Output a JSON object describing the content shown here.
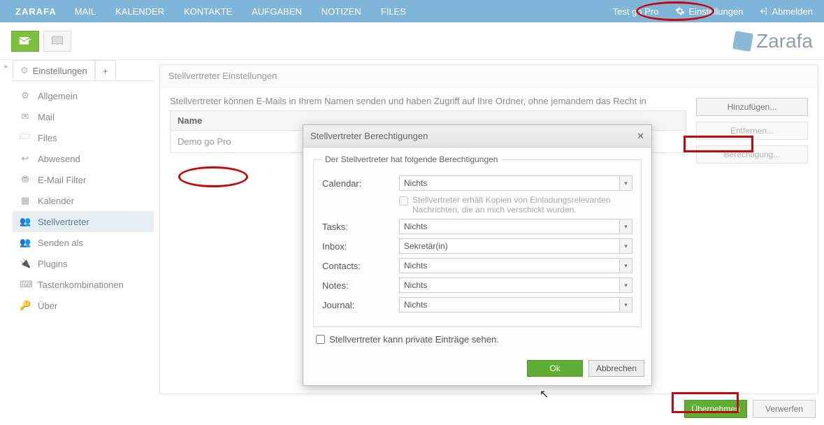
{
  "topnav": {
    "brand": "ZARAFA",
    "items": [
      "MAIL",
      "KALENDER",
      "KONTAKTE",
      "AUFGABEN",
      "NOTIZEN",
      "FILES"
    ],
    "user": "Test go Pro",
    "settings": "Einstellungen",
    "logout": "Abmelden"
  },
  "logo_text": "Zarafa",
  "tabs": {
    "settings_tab": "Einstellungen"
  },
  "sidenav": [
    {
      "label": "Allgemein",
      "icon": "⚙"
    },
    {
      "label": "Mail",
      "icon": "✉"
    },
    {
      "label": "Files",
      "icon": "🗁"
    },
    {
      "label": "Abwesend",
      "icon": "↩"
    },
    {
      "label": "E-Mail Filter",
      "icon": "⛃"
    },
    {
      "label": "Kalender",
      "icon": "▦"
    },
    {
      "label": "Stellvertreter",
      "icon": "👥"
    },
    {
      "label": "Senden als",
      "icon": "👥"
    },
    {
      "label": "Plugins",
      "icon": "🔌"
    },
    {
      "label": "Tastenkombinationen",
      "icon": "⌨"
    },
    {
      "label": "Über",
      "icon": "🔑"
    }
  ],
  "panel": {
    "title": "Stellvertreter Einstellungen",
    "desc": "Stellvertreter können E-Mails in Ihrem Namen senden und haben Zugriff auf Ihre Ordner, ohne jemandem das Recht in",
    "name_col": "Name",
    "row0": "Demo go Pro",
    "add": "Hinzufügen...",
    "remove": "Entfernen...",
    "perm": "Berechtigung..."
  },
  "footer": {
    "apply": "Übernehmen",
    "discard": "Verwerfen"
  },
  "modal": {
    "title": "Stellvertreter Berechtigungen",
    "legend": "Der Stellvertreter hat folgende Berechtigungen",
    "calendar_lbl": "Calendar:",
    "calendar_val": "Nichts",
    "copy_check": "Stellvertreter erhält Kopien von Einladungsrelevanten Nachrichten, die an mich verschickt wurden.",
    "tasks_lbl": "Tasks:",
    "tasks_val": "Nichts",
    "inbox_lbl": "Inbox:",
    "inbox_val": "Sekretär(in)",
    "contacts_lbl": "Contacts:",
    "contacts_val": "Nichts",
    "notes_lbl": "Notes:",
    "notes_val": "Nichts",
    "journal_lbl": "Journal:",
    "journal_val": "Nichts",
    "private_lbl": "Stellvertreter kann private Einträge sehen.",
    "ok": "Ok",
    "cancel": "Abbrechen"
  }
}
